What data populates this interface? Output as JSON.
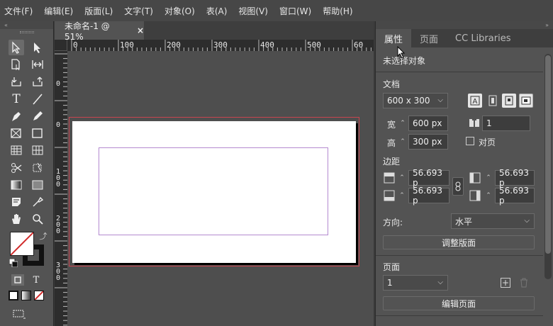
{
  "menu": [
    "文件(F)",
    "编辑(E)",
    "版面(L)",
    "文字(T)",
    "对象(O)",
    "表(A)",
    "视图(V)",
    "窗口(W)",
    "帮助(H)"
  ],
  "document": {
    "tab_title": "未命名-1 @ 51%",
    "close_glyph": "×"
  },
  "panel_collapse": {
    "left": "«",
    "right": "»"
  },
  "hruler": [
    "0",
    "100",
    "200",
    "300",
    "400",
    "500",
    "60"
  ],
  "vruler": [
    "0",
    "0",
    "1 0 0",
    "2 0 0",
    "3 0 0"
  ],
  "tools_label": {
    "type_tool": "T",
    "frame_text_tool": "T"
  },
  "properties": {
    "tabs": [
      "属性",
      "页面",
      "CC Libraries"
    ],
    "status": "未选择对象",
    "doc_section": "文档",
    "page_size": "600 x 300",
    "width_label": "宽",
    "width_value": "600 px",
    "height_label": "高",
    "height_value": "300 px",
    "pages_value": "1",
    "facing_pages_label": "对页",
    "margins_section": "边距",
    "margin_top": "56.693 p",
    "margin_bottom": "56.693 p",
    "margin_left": "56.693 p",
    "margin_right": "56.693 p",
    "orientation_label": "方向:",
    "orientation_value": "水平",
    "adjust_layout_button": "调整版面",
    "page_section": "页面",
    "page_value": "1",
    "edit_page_button": "编辑页面"
  }
}
